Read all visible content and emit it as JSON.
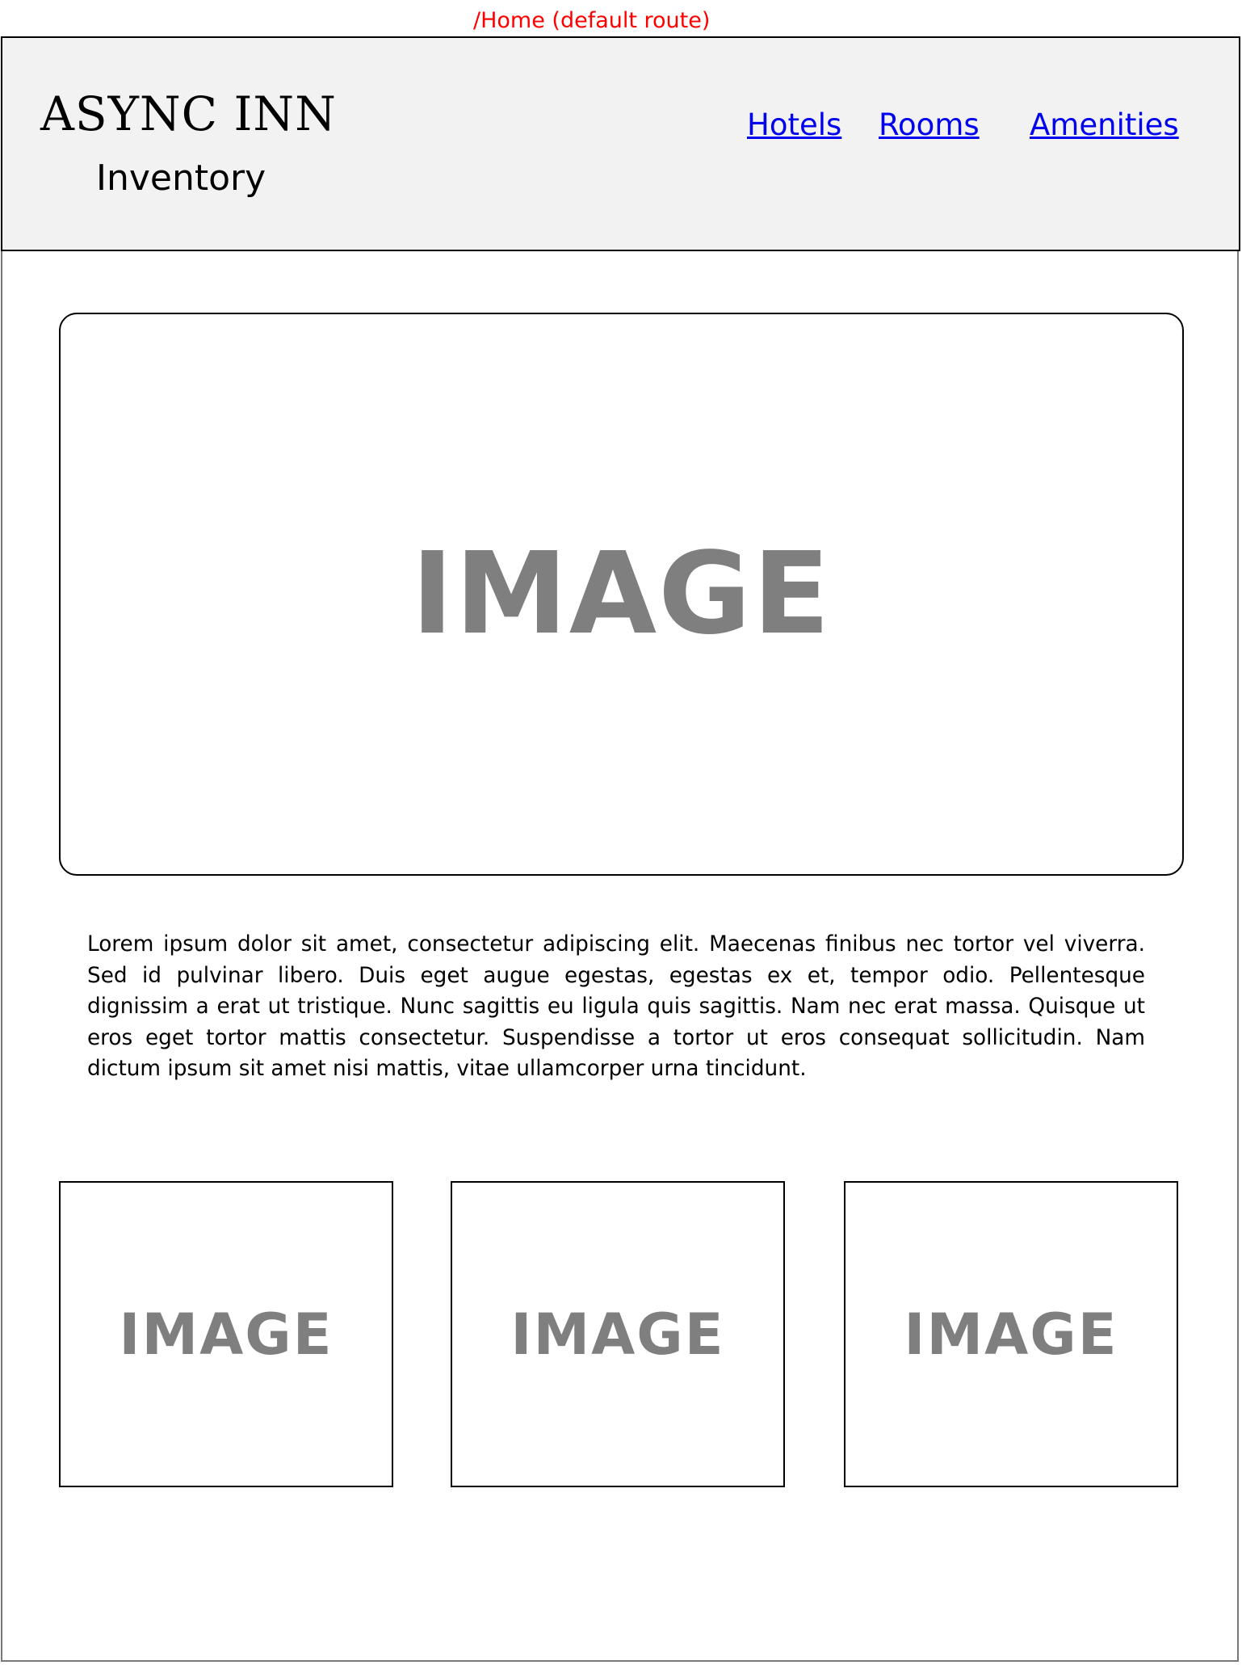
{
  "route_label": "/Home (default route)",
  "header": {
    "title": "ASYNC INN",
    "subtitle": "Inventory",
    "nav": [
      {
        "label": "Hotels"
      },
      {
        "label": "Rooms"
      },
      {
        "label": "Amenities"
      }
    ]
  },
  "hero": {
    "placeholder": "IMAGE"
  },
  "description": "Lorem ipsum dolor sit amet, consectetur adipiscing elit. Maecenas finibus nec tortor vel viverra. Sed id pulvinar libero. Duis eget augue egestas, egestas ex et, tempor odio. Pellentesque dignissim a erat ut tristique. Nunc sagittis eu ligula quis sagittis. Nam nec erat massa. Quisque ut eros eget tortor mattis consectetur. Suspendisse a tortor ut eros consequat sollicitudin. Nam dictum ipsum sit amet nisi mattis, vitae ullamcorper urna tincidunt.",
  "thumbnails": [
    {
      "placeholder": "IMAGE"
    },
    {
      "placeholder": "IMAGE"
    },
    {
      "placeholder": "IMAGE"
    }
  ],
  "colors": {
    "route_label": "#ff0000",
    "header_background": "#f2f2f2",
    "link": "#0000ee",
    "placeholder_text": "#7f7f7f"
  }
}
